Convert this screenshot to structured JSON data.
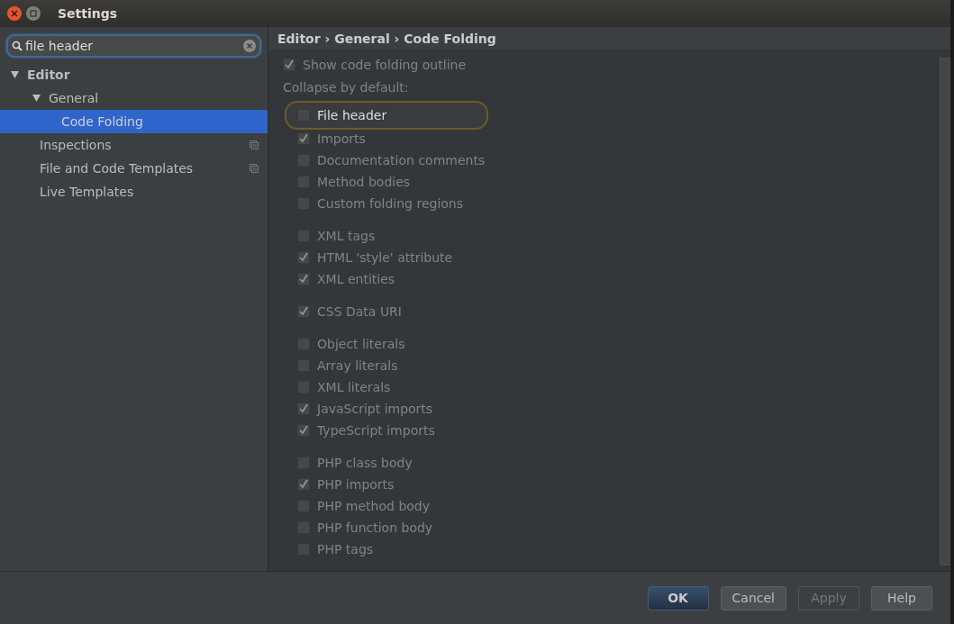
{
  "window": {
    "title": "Settings"
  },
  "search": {
    "value": "file header"
  },
  "tree": [
    {
      "label": "Editor",
      "expanded": true,
      "selected": false,
      "children": [
        {
          "label": "General",
          "expanded": true,
          "selected": false,
          "children": [
            {
              "label": "Code Folding",
              "selected": true
            }
          ]
        },
        {
          "label": "Inspections",
          "selected": false,
          "project_icon": true
        },
        {
          "label": "File and Code Templates",
          "selected": false,
          "project_icon": true
        },
        {
          "label": "Live Templates",
          "selected": false
        }
      ]
    }
  ],
  "breadcrumb": {
    "items": [
      "Editor",
      "General",
      "Code Folding"
    ],
    "separator": "›"
  },
  "show_outline": {
    "label": "Show code folding outline",
    "checked": true
  },
  "collapse_label": "Collapse by default:",
  "groups": [
    [
      {
        "label": "File header",
        "checked": false,
        "highlighted": true
      },
      {
        "label": "Imports",
        "checked": true,
        "highlighted": false
      },
      {
        "label": "Documentation comments",
        "checked": false,
        "highlighted": false
      },
      {
        "label": "Method bodies",
        "checked": false,
        "highlighted": false
      },
      {
        "label": "Custom folding regions",
        "checked": false,
        "highlighted": false
      }
    ],
    [
      {
        "label": "XML tags",
        "checked": false,
        "highlighted": false
      },
      {
        "label": "HTML 'style' attribute",
        "checked": true,
        "highlighted": false
      },
      {
        "label": "XML entities",
        "checked": true,
        "highlighted": false
      }
    ],
    [
      {
        "label": "CSS Data URI",
        "checked": true,
        "highlighted": false
      }
    ],
    [
      {
        "label": "Object literals",
        "checked": false,
        "highlighted": false
      },
      {
        "label": "Array literals",
        "checked": false,
        "highlighted": false
      },
      {
        "label": "XML literals",
        "checked": false,
        "highlighted": false
      },
      {
        "label": "JavaScript imports",
        "checked": true,
        "highlighted": false
      },
      {
        "label": "TypeScript imports",
        "checked": true,
        "highlighted": false
      }
    ],
    [
      {
        "label": "PHP class body",
        "checked": false,
        "highlighted": false
      },
      {
        "label": "PHP imports",
        "checked": true,
        "highlighted": false
      },
      {
        "label": "PHP method body",
        "checked": false,
        "highlighted": false
      },
      {
        "label": "PHP function body",
        "checked": false,
        "highlighted": false
      },
      {
        "label": "PHP tags",
        "checked": false,
        "highlighted": false
      }
    ]
  ],
  "buttons": [
    {
      "label": "OK",
      "kind": "default",
      "disabled": false
    },
    {
      "label": "Cancel",
      "kind": "normal",
      "disabled": false
    },
    {
      "label": "Apply",
      "kind": "normal",
      "disabled": true
    },
    {
      "label": "Help",
      "kind": "normal",
      "disabled": false
    }
  ]
}
